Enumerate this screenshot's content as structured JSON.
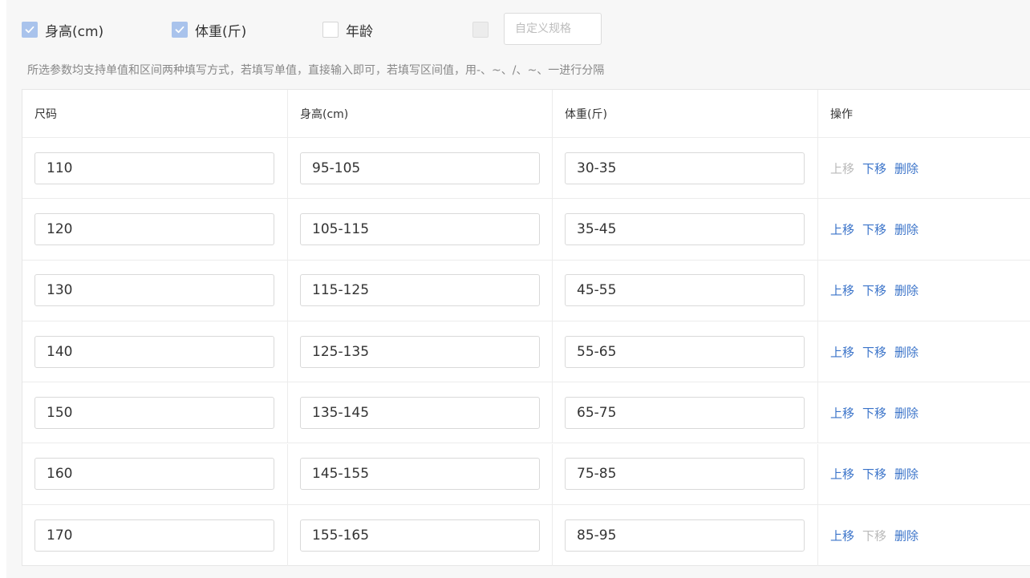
{
  "options": {
    "height": {
      "label": "身高(cm)",
      "checked": true
    },
    "weight": {
      "label": "体重(斤)",
      "checked": true
    },
    "age": {
      "label": "年龄",
      "checked": false
    },
    "custom": {
      "checked": false,
      "disabled": true,
      "placeholder": "自定义规格"
    }
  },
  "hint": "所选参数均支持单值和区间两种填写方式，若填写单值，直接输入即可，若填写区间值，用-、~、/、~、一进行分隔",
  "table": {
    "headers": {
      "size": "尺码",
      "height": "身高(cm)",
      "weight": "体重(斤)",
      "actions": "操作"
    },
    "actions": {
      "up": "上移",
      "down": "下移",
      "delete": "删除"
    },
    "rows": [
      {
        "size": "110",
        "height": "95-105",
        "weight": "30-35",
        "up_enabled": false,
        "down_enabled": true
      },
      {
        "size": "120",
        "height": "105-115",
        "weight": "35-45",
        "up_enabled": true,
        "down_enabled": true
      },
      {
        "size": "130",
        "height": "115-125",
        "weight": "45-55",
        "up_enabled": true,
        "down_enabled": true
      },
      {
        "size": "140",
        "height": "125-135",
        "weight": "55-65",
        "up_enabled": true,
        "down_enabled": true
      },
      {
        "size": "150",
        "height": "135-145",
        "weight": "65-75",
        "up_enabled": true,
        "down_enabled": true
      },
      {
        "size": "160",
        "height": "145-155",
        "weight": "75-85",
        "up_enabled": true,
        "down_enabled": true
      },
      {
        "size": "170",
        "height": "155-165",
        "weight": "85-95",
        "up_enabled": true,
        "down_enabled": false
      }
    ]
  },
  "colors": {
    "accent": "#3a73c9",
    "checkbox_checked": "#a9c3ec",
    "disabled_text": "#b9b9b9"
  }
}
